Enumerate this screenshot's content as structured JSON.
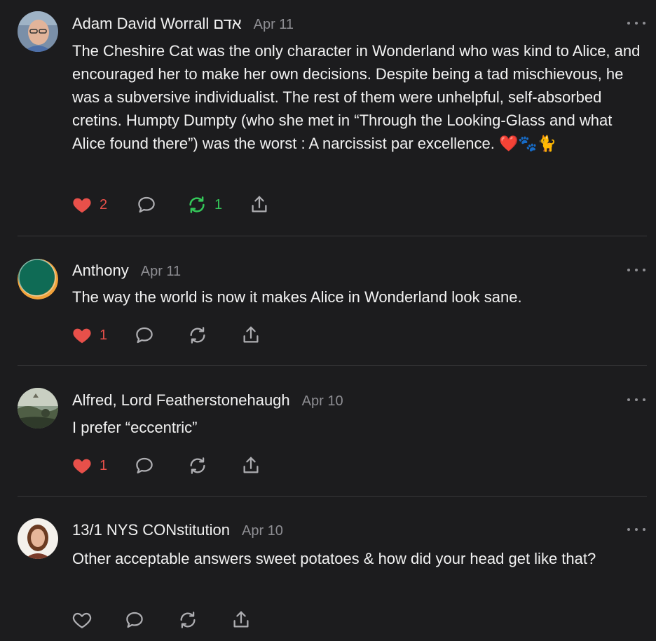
{
  "colors": {
    "background": "#1c1c1e",
    "like_active": "#e8504a",
    "restack_active": "#34c759",
    "muted": "#8e8e93"
  },
  "comments": [
    {
      "author": "Adam David Worrall אדם",
      "date": "Apr 11",
      "avatar": "photo-man-glasses",
      "text": "The Cheshire Cat was the only character in Wonderland who was kind to Alice, and encouraged her to make her own decisions. Despite being a tad mischievous, he was a subversive individualist. The rest of them were unhelpful, self-absorbed cretins. Humpty Dumpty (who she met in “Through the Looking-Glass and what Alice found there”) was the worst : A narcissist par excellence.",
      "emoji": "❤️🐾🐈",
      "likes": "2",
      "restacks": "1",
      "liked": true,
      "restacked": true
    },
    {
      "author": "Anthony",
      "date": "Apr 11",
      "avatar": "green-circle-logo",
      "text": "The way the world is now it makes Alice in Wonderland look sane.",
      "likes": "1",
      "liked": true,
      "restacked": false
    },
    {
      "author": "Alfred, Lord Featherstonehaugh",
      "date": "Apr 10",
      "avatar": "landscape-painting",
      "text": "I prefer “eccentric”",
      "likes": "1",
      "liked": true,
      "restacked": false
    },
    {
      "author": "13/1 NYS CONstitution",
      "date": "Apr 10",
      "avatar": "photo-woman",
      "text": "Other acceptable answers sweet potatoes & how did your head get like that?",
      "liked": false,
      "restacked": false
    }
  ],
  "icons": {
    "like": "heart-icon",
    "reply": "speech-bubble-icon",
    "restack": "restack-arrows-icon",
    "share": "share-upload-icon",
    "more": "ellipsis-icon"
  }
}
